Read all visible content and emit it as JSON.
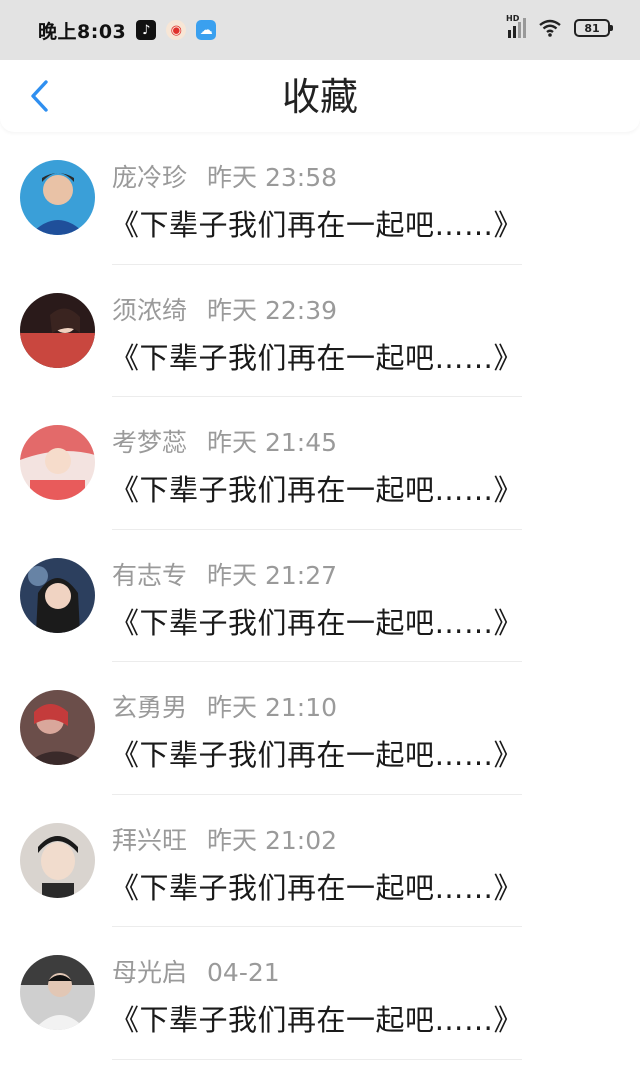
{
  "status_bar": {
    "time": "晚上8:03",
    "apps": [
      "tiktok-icon",
      "weibo-icon",
      "cloud-icon"
    ],
    "signal_label": "HD",
    "battery": "81"
  },
  "header": {
    "title": "收藏",
    "back_icon": "chevron-left-icon",
    "accent": "#2f8ff0"
  },
  "favorites": [
    {
      "name": "庞冷珍",
      "time": "昨天 23:58",
      "content": "《下辈子我们再在一起吧……》",
      "avatar_color": "#3a9fd8"
    },
    {
      "name": "须浓绮",
      "time": "昨天 22:39",
      "content": "《下辈子我们再在一起吧……》",
      "avatar_color": "#c9473f"
    },
    {
      "name": "考梦蕊",
      "time": "昨天 21:45",
      "content": "《下辈子我们再在一起吧……》",
      "avatar_color": "#e36a6a"
    },
    {
      "name": "有志专",
      "time": "昨天 21:27",
      "content": "《下辈子我们再在一起吧……》",
      "avatar_color": "#2c3f5e"
    },
    {
      "name": "玄勇男",
      "time": "昨天 21:10",
      "content": "《下辈子我们再在一起吧……》",
      "avatar_color": "#6b4e4a"
    },
    {
      "name": "拜兴旺",
      "time": "昨天 21:02",
      "content": "《下辈子我们再在一起吧……》",
      "avatar_color": "#d9d4cf"
    },
    {
      "name": "母光启",
      "time": "04-21",
      "content": "《下辈子我们再在一起吧……》",
      "avatar_color": "#3d3d3d"
    }
  ]
}
